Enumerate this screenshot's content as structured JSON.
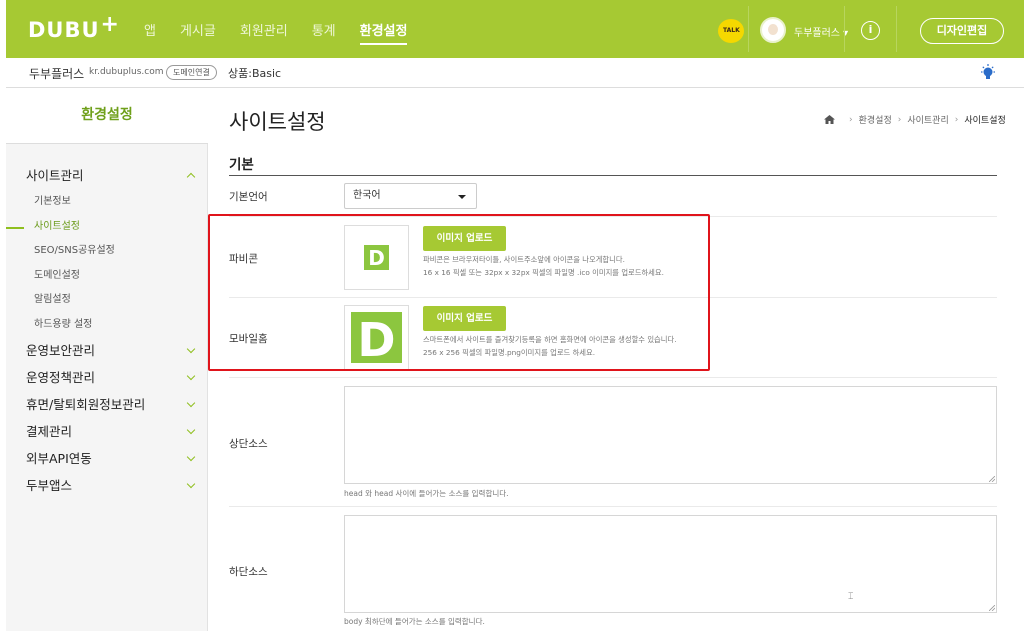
{
  "brand": {
    "logo_text": "DUBU",
    "logo_plus": "+",
    "accent": "#a6c933",
    "highlight": "#e0141b"
  },
  "topnav": {
    "items": [
      {
        "label": "앱"
      },
      {
        "label": "게시글"
      },
      {
        "label": "회원관리"
      },
      {
        "label": "통계"
      },
      {
        "label": "환경설정",
        "active": true
      }
    ],
    "talk_label": "TALK",
    "user_label": "두부플러스 ▾",
    "info_label": "i",
    "design_button": "디자인편집"
  },
  "subbar": {
    "site_name": "두부플러스",
    "site_url": "kr.dubuplus.com",
    "domain_link": "도메인연결",
    "product": "상품:Basic"
  },
  "sidebar": {
    "title": "환경설정",
    "groups": [
      {
        "label": "사이트관리",
        "expanded": true,
        "items": [
          "기본정보",
          "사이트설정",
          "SEO/SNS공유설정",
          "도메인설정",
          "알림설정",
          "하드용량 설정"
        ],
        "active_item": "사이트설정"
      },
      {
        "label": "운영보안관리"
      },
      {
        "label": "운영정책관리"
      },
      {
        "label": "휴면/탈퇴회원정보관리"
      },
      {
        "label": "결제관리"
      },
      {
        "label": "외부API연동"
      },
      {
        "label": "두부앱스"
      }
    ]
  },
  "main": {
    "title": "사이트설정",
    "breadcrumb": [
      "환경설정",
      "사이트관리",
      "사이트설정"
    ],
    "section_title": "기본",
    "language": {
      "label": "기본언어",
      "value": "한국어"
    },
    "favicon": {
      "label": "파비콘",
      "letter": "D",
      "button": "이미지 업로드",
      "help_1": "파비콘은 브라우저타이틀, 사이트주소앞에 아이콘을 나오게합니다.",
      "help_2": "16 x 16 픽셀 또는 32px x 32px 픽셀의 파일명 .ico 이미지를 업로드하세요."
    },
    "mobile_home": {
      "label": "모바일홈",
      "letter": "D",
      "button": "이미지 업로드",
      "help_1": "스마트폰에서 사이트를 즐겨찾기등록을 하면 홈화면에 아이콘을 생성할수 있습니다.",
      "help_2": "256 x 256 픽셀의 파일명.png이미지를 업로드 하세요."
    },
    "top_source": {
      "label": "상단소스",
      "note": "head 와 head 사이에 들어가는 소스를 입력합니다."
    },
    "bottom_source": {
      "label": "하단소스",
      "note": "body 최하단에 들어가는 소스를 입력합니다."
    }
  }
}
